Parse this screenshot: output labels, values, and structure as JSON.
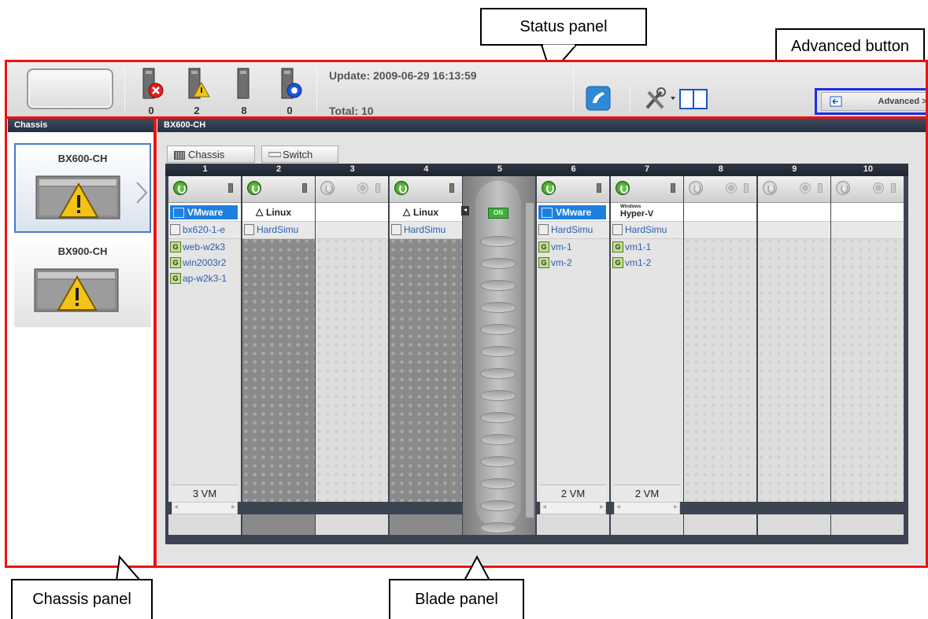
{
  "callouts": {
    "status_panel": "Status panel",
    "advanced_button": "Advanced button",
    "chassis_panel": "Chassis panel",
    "blade_panel": "Blade panel"
  },
  "status": {
    "counts": [
      {
        "icon": "error-server-icon",
        "value": "0"
      },
      {
        "icon": "warning-server-icon",
        "value": "2"
      },
      {
        "icon": "normal-server-icon",
        "value": "8"
      },
      {
        "icon": "stopped-server-icon",
        "value": "0"
      }
    ],
    "update": "Update: 2009-06-29 16:13:59",
    "total": "Total: 10",
    "advanced_label": "Advanced >>"
  },
  "chassis": {
    "header": "Chassis",
    "items": [
      {
        "name": "BX600-CH",
        "status": "warning",
        "selected": true
      },
      {
        "name": "BX900-CH",
        "status": "warning",
        "selected": false
      }
    ]
  },
  "blade": {
    "header": "BX600-CH",
    "tabs": [
      "Chassis",
      "Switch"
    ],
    "slot_numbers": [
      "1",
      "2",
      "3",
      "4",
      "5",
      "6",
      "7",
      "8",
      "9",
      "10"
    ],
    "switch_state": "ON",
    "slots": [
      {
        "power": "on",
        "os": "VMware",
        "physical": "bx620-1-e",
        "vms": [
          "web-w2k3",
          "win2003r2",
          "ap-w2k3-1"
        ],
        "vm_count": "3 VM"
      },
      {
        "power": "on",
        "os": "Linux",
        "physical": "HardSimu",
        "vms": [],
        "vm_count": ""
      },
      {
        "power": "off",
        "os": "",
        "physical": "",
        "vms": [],
        "vm_count": ""
      },
      {
        "power": "on",
        "os": "Linux",
        "physical": "HardSimu",
        "vms": [],
        "vm_count": ""
      },
      {
        "power": "switch",
        "os": "",
        "physical": "",
        "vms": [],
        "vm_count": ""
      },
      {
        "power": "on",
        "os": "VMware",
        "physical": "HardSimu",
        "vms": [
          "vm-1",
          "vm-2"
        ],
        "vm_count": "2 VM"
      },
      {
        "power": "on",
        "os": "Hyper-V",
        "os_small": "Windows",
        "physical": "HardSimu",
        "vms": [
          "vm1-1",
          "vm1-2"
        ],
        "vm_count": "2 VM"
      },
      {
        "power": "off",
        "os": "",
        "physical": "",
        "vms": [],
        "vm_count": ""
      },
      {
        "power": "off",
        "os": "",
        "physical": "",
        "vms": [],
        "vm_count": ""
      },
      {
        "power": "off",
        "os": "",
        "physical": "",
        "vms": [],
        "vm_count": ""
      }
    ]
  },
  "colors": {
    "highlight_red": "#ee1111",
    "advanced_outline": "#1a2ee6",
    "link_blue": "#2a5db0",
    "vmware_blue": "#1e7fe0",
    "power_green": "#2c8a1a"
  }
}
